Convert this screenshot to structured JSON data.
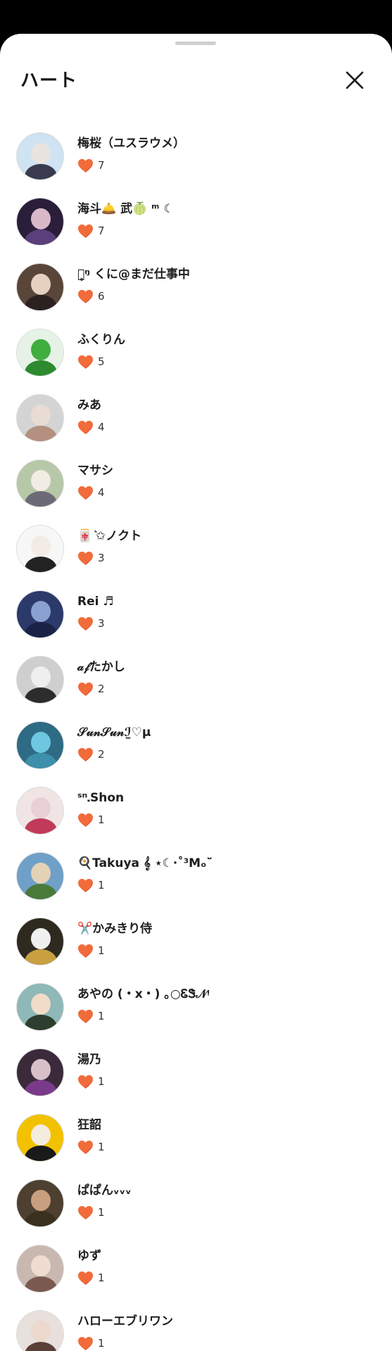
{
  "header": {
    "title": "ハート",
    "close_icon": "close-icon"
  },
  "colors": {
    "heart": "#f26b3a",
    "heart_shade": "#d8502a"
  },
  "users": [
    {
      "name": "梅桜（ユスラウメ）",
      "hearts": "7",
      "bg": "#cfe3f2",
      "skin": "#e9e4df",
      "cloth": "#3a3a4e"
    },
    {
      "name": "海斗🛎️ 武🍈 ᵐ ☾",
      "hearts": "7",
      "bg": "#2a1e3a",
      "skin": "#d9b8c8",
      "cloth": "#5a3f7a"
    },
    {
      "name": "ｋ̥ᵑ くに@まだ仕事中",
      "hearts": "6",
      "bg": "#5a4638",
      "skin": "#e6d0c0",
      "cloth": "#2b2220"
    },
    {
      "name": "ふくりん",
      "hearts": "5",
      "bg": "#e6f2e6",
      "skin": "#3fae3f",
      "cloth": "#2e8a2e"
    },
    {
      "name": "みあ",
      "hearts": "4",
      "bg": "#d4d4d4",
      "skin": "#e8dcd4",
      "cloth": "#b39080"
    },
    {
      "name": "マサシ",
      "hearts": "4",
      "bg": "#b7c8a8",
      "skin": "#f2ece4",
      "cloth": "#6d6a78"
    },
    {
      "name": "🀄 ͛✩ノクト",
      "hearts": "3",
      "bg": "#f7f7f7",
      "skin": "#f2ece4",
      "cloth": "#222222"
    },
    {
      "name": "Rei ♬",
      "hearts": "3",
      "bg": "#2b3a6a",
      "skin": "#8aa0d0",
      "cloth": "#1a2246"
    },
    {
      "name": "𝒶𝒻たかし",
      "hearts": "2",
      "bg": "#cfcfcf",
      "skin": "#efefef",
      "cloth": "#2c2c2c"
    },
    {
      "name": "𝒮𝓊𝓃𝒮𝓊𝓃ℐ̫♡μ",
      "hearts": "2",
      "bg": "#2f6b84",
      "skin": "#6ec6e0",
      "cloth": "#3d8fab"
    },
    {
      "name": "ˢⁿ᎐Shon",
      "hearts": "1",
      "bg": "#f0e4e4",
      "skin": "#e8d0d4",
      "cloth": "#c23a5a"
    },
    {
      "name": "🍳Takuya 𝄞 ⋆☾·˚³Mₒ˘̈",
      "hearts": "1",
      "bg": "#6fa0c8",
      "skin": "#e3d2b6",
      "cloth": "#4a7a3a"
    },
    {
      "name": "✂️かみきり侍",
      "hearts": "1",
      "bg": "#2e2a20",
      "skin": "#f0f0f0",
      "cloth": "#c8a040"
    },
    {
      "name": "あやの (・x・) ｡○ᏋᏕ𝒩ᵎ",
      "hearts": "1",
      "bg": "#8fb8b8",
      "skin": "#f0dcc8",
      "cloth": "#2e3e2e"
    },
    {
      "name": "湯乃",
      "hearts": "1",
      "bg": "#3a2a3a",
      "skin": "#d8c0c8",
      "cloth": "#7a3a8a"
    },
    {
      "name": "狂韶",
      "hearts": "1",
      "bg": "#f2c200",
      "skin": "#f5ece0",
      "cloth": "#1a1a1a"
    },
    {
      "name": "ぱぱんᵥᵥᵥ",
      "hearts": "1",
      "bg": "#4e4030",
      "skin": "#c8a080",
      "cloth": "#3a3020"
    },
    {
      "name": "ゆず",
      "hearts": "1",
      "bg": "#c8b8b0",
      "skin": "#f0dcd0",
      "cloth": "#7a5a50"
    },
    {
      "name": "ハローエブリワン",
      "hearts": "1",
      "bg": "#e8e0dc",
      "skin": "#ecd8cc",
      "cloth": "#5a4038"
    }
  ]
}
